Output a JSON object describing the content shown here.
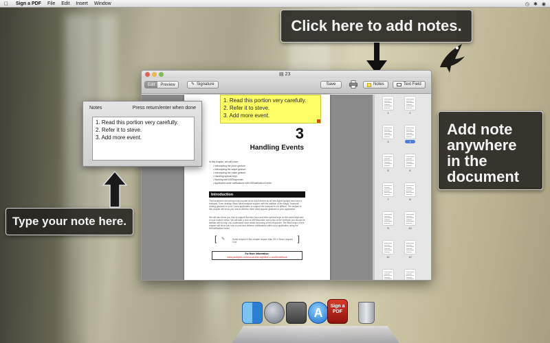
{
  "menubar": {
    "app_name": "Sign a PDF",
    "items": [
      "File",
      "Edit",
      "Insert",
      "Window"
    ]
  },
  "callouts": {
    "top": "Click here to add notes.",
    "left": "Type your note here.",
    "right": "Add note anywhere in the document"
  },
  "window": {
    "title": "23",
    "mode_edit": "Edit",
    "mode_preview": "Preview",
    "signature_button": "Signature",
    "save_button": "Save",
    "notes_button": "Notes",
    "text_field_button": "Text Field"
  },
  "notes_panel": {
    "title": "Notes",
    "hint": "Press return/enter when done",
    "text": "1. Read this portion very carefully.\n2. Refer it to steve.\n3. Add more event."
  },
  "document": {
    "sticky_lines": [
      "1. Read this portion very carefully.",
      "2. Refer it to steve.",
      "3. Add more event."
    ],
    "chapter_number": "3",
    "chapter_title": "Handling Events",
    "intro_lead": "In this chapter, we will cover:",
    "bullets": [
      "Intercepting the pinch gesture",
      "Intercepting the swipe gesture",
      "Intercepting the rotate gesture",
      "Handling special keys",
      "Working with NSResponder",
      "Application-wide notifications with NSNotificationCenter"
    ],
    "section_heading": "Introduction",
    "para1": "The trackpad is becoming more popular as an input device as all new Apple laptops now have a trackpad. Even desktop Macs have trackpad support with the addition of the Magic Trackpad. Adding gestures to your Cocoa application to support the trackpad is not difficult. The recipes in this chapter will show you how to add the three most popular gestures to your application.",
    "para2": "We will also show you how to support function keys and other special keys on the users keyboard in your custom views. We will take a look at NSResponder and a few of the methods you should be familiar with to help you understand more about becoming a first responder. The final recipe of this chapter will show you how to post and observe notifications within your application using the NSNotificationCenter.",
    "tip_text": "Some recipes in this chapter require Mac OS X Snow Leopard 10.6.",
    "more_info_label": "For More Information:",
    "more_info_url": "www.packtpub.com/cocoa-and-objective-c-cookbook/book"
  },
  "thumbnails": [
    "1",
    "2",
    "3",
    "4",
    "5",
    "6",
    "7",
    "8",
    "9",
    "10",
    "11",
    "12",
    "13",
    "14",
    "15",
    "16"
  ],
  "selected_thumbnail": "4",
  "dock": [
    "finder-icon",
    "launchpad-icon",
    "image-capture-icon",
    "app-store-icon",
    "sign-a-pdf-icon",
    "trash-icon"
  ],
  "dock_labels": {
    "sign_a_pdf": "Sign a PDF"
  }
}
